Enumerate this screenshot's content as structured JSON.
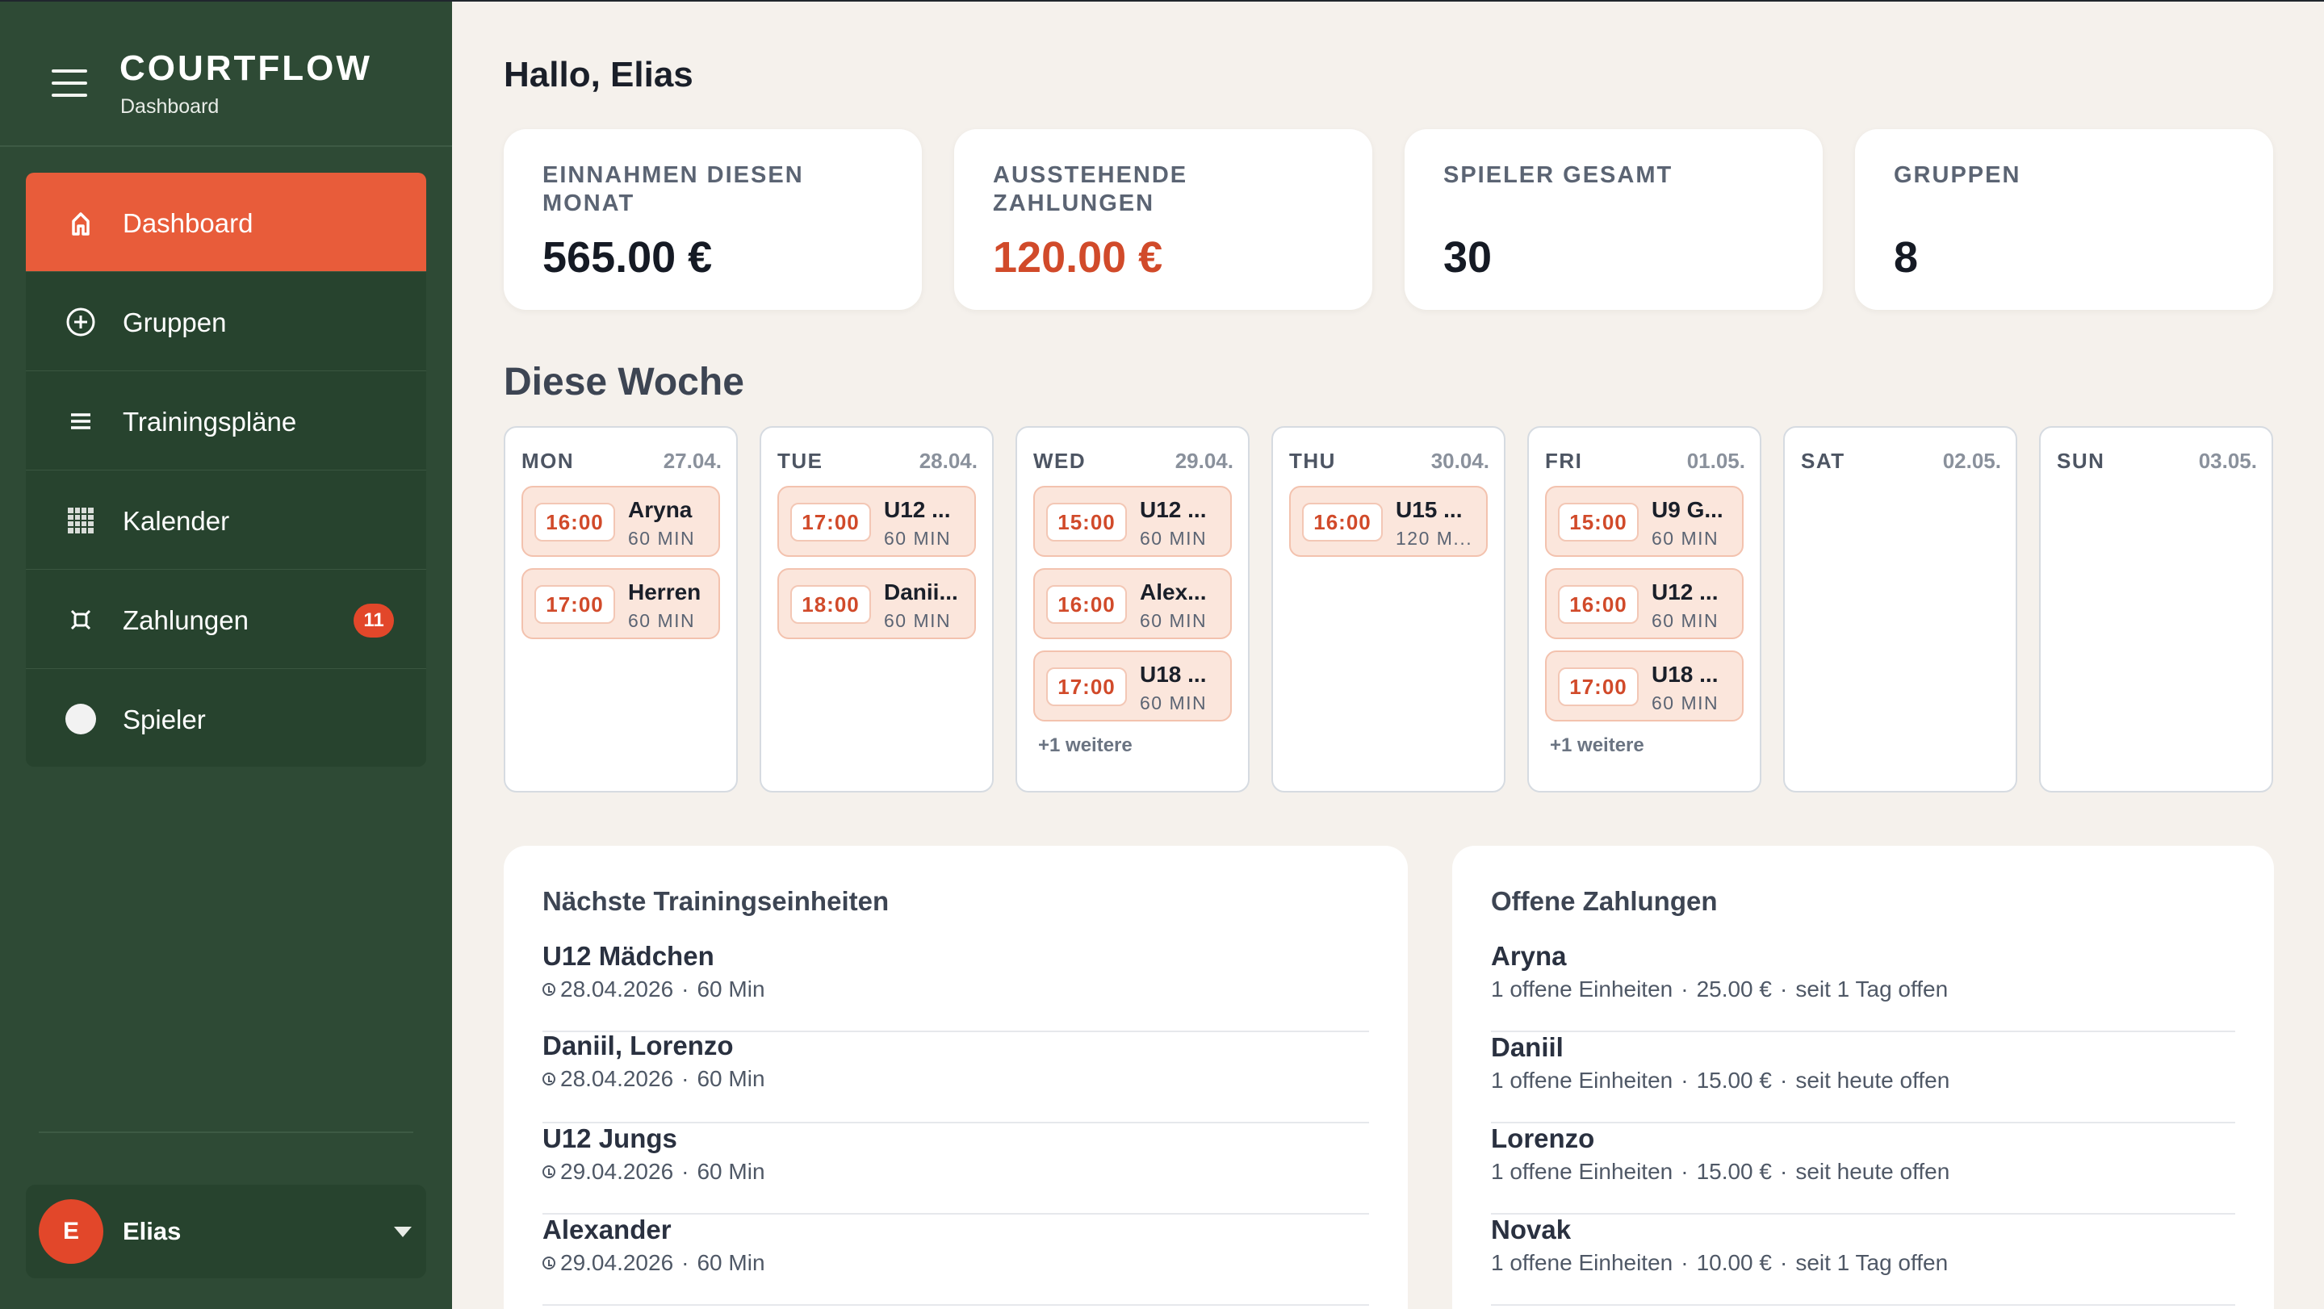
{
  "app": {
    "name": "COURTFLOW",
    "subtitle": "Dashboard"
  },
  "sidebar": {
    "items": [
      {
        "label": "Dashboard",
        "icon": "home-icon",
        "active": true
      },
      {
        "label": "Gruppen",
        "icon": "plus-circle-icon"
      },
      {
        "label": "Trainingspläne",
        "icon": "list-icon"
      },
      {
        "label": "Kalender",
        "icon": "calendar-grid-icon"
      },
      {
        "label": "Zahlungen",
        "icon": "currency-icon",
        "badge": "11"
      },
      {
        "label": "Spieler",
        "icon": "user-dot-icon"
      }
    ],
    "user": {
      "initial": "E",
      "name": "Elias"
    }
  },
  "main": {
    "greeting": "Hallo, Elias",
    "stats": [
      {
        "label": "Einnahmen diesen Monat",
        "value": "565.00 €"
      },
      {
        "label": "Ausstehende Zahlungen",
        "value": "120.00 €"
      },
      {
        "label": "Spieler gesamt",
        "value": "30"
      },
      {
        "label": "Gruppen",
        "value": "8"
      }
    ],
    "week": {
      "title": "Diese Woche",
      "days": [
        {
          "name": "MON",
          "date": "27.04.",
          "events": [
            {
              "time": "16:00",
              "title": "Aryna",
              "duration": "60 MIN"
            },
            {
              "time": "17:00",
              "title": "Herren",
              "duration": "60 MIN"
            }
          ]
        },
        {
          "name": "TUE",
          "date": "28.04.",
          "events": [
            {
              "time": "17:00",
              "title": "U12 ...",
              "duration": "60 MIN"
            },
            {
              "time": "18:00",
              "title": "Danii...",
              "duration": "60 MIN"
            }
          ]
        },
        {
          "name": "WED",
          "date": "29.04.",
          "events": [
            {
              "time": "15:00",
              "title": "U12 ...",
              "duration": "60 MIN"
            },
            {
              "time": "16:00",
              "title": "Alex...",
              "duration": "60 MIN"
            },
            {
              "time": "17:00",
              "title": "U18 ...",
              "duration": "60 MIN"
            }
          ],
          "more": "+1 weitere"
        },
        {
          "name": "THU",
          "date": "30.04.",
          "events": [
            {
              "time": "16:00",
              "title": "U15 ...",
              "duration": "120 M..."
            }
          ]
        },
        {
          "name": "FRI",
          "date": "01.05.",
          "events": [
            {
              "time": "15:00",
              "title": "U9 G...",
              "duration": "60 MIN"
            },
            {
              "time": "16:00",
              "title": "U12 ...",
              "duration": "60 MIN"
            },
            {
              "time": "17:00",
              "title": "U18 ...",
              "duration": "60 MIN"
            }
          ],
          "more": "+1 weitere"
        },
        {
          "name": "SAT",
          "date": "02.05.",
          "events": []
        },
        {
          "name": "SUN",
          "date": "03.05.",
          "events": []
        }
      ]
    },
    "upcoming": {
      "title": "Nächste Trainingseinheiten",
      "items": [
        {
          "name": "U12 Mädchen",
          "date": "28.04.2026",
          "duration": "60 Min"
        },
        {
          "name": "Daniil, Lorenzo",
          "date": "28.04.2026",
          "duration": "60 Min"
        },
        {
          "name": "U12 Jungs",
          "date": "29.04.2026",
          "duration": "60 Min"
        },
        {
          "name": "Alexander",
          "date": "29.04.2026",
          "duration": "60 Min"
        }
      ]
    },
    "payments": {
      "title": "Offene Zahlungen",
      "items": [
        {
          "name": "Aryna",
          "units": "1 offene Einheiten",
          "amount": "25.00 €",
          "since": "seit 1 Tag offen"
        },
        {
          "name": "Daniil",
          "units": "1 offene Einheiten",
          "amount": "15.00 €",
          "since": "seit heute offen"
        },
        {
          "name": "Lorenzo",
          "units": "1 offene Einheiten",
          "amount": "15.00 €",
          "since": "seit heute offen"
        },
        {
          "name": "Novak",
          "units": "1 offene Einheiten",
          "amount": "10.00 €",
          "since": "seit 1 Tag offen"
        }
      ]
    }
  },
  "colors": {
    "sidebar": "#2e4a35",
    "accent": "#e85c3a",
    "badge": "#e2472a",
    "background": "#f5f1ec"
  }
}
